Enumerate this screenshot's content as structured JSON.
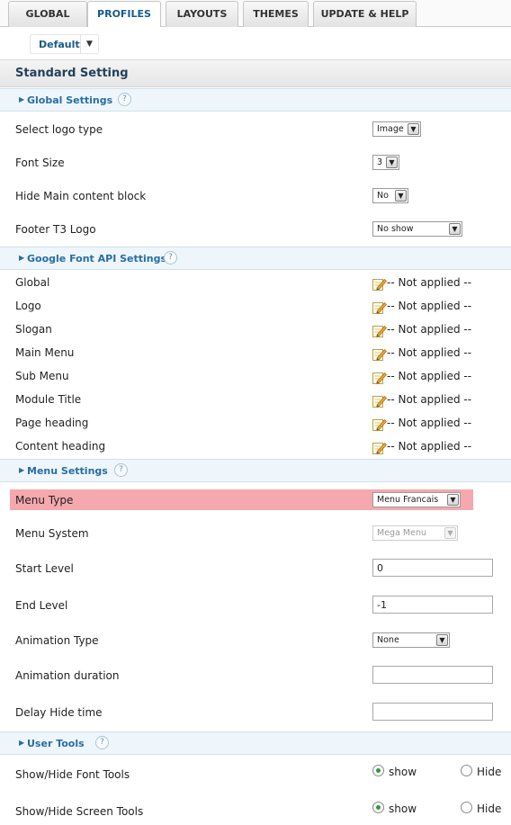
{
  "tabs": [
    "GLOBAL",
    "PROFILES",
    "LAYOUTS",
    "THEMES",
    "UPDATE & HELP"
  ],
  "active_tab": "PROFILES",
  "profile": {
    "selected": "Default"
  },
  "page_title": "Standard Setting",
  "help_glyph": "?",
  "sections": {
    "global": {
      "title": "Global Settings"
    },
    "google_font": {
      "title": "Google Font API Settings"
    },
    "menu": {
      "title": "Menu Settings"
    },
    "user_tools": {
      "title": "User Tools"
    }
  },
  "global_settings": {
    "logo_type": {
      "label": "Select logo type",
      "value": "Image"
    },
    "font_size": {
      "label": "Font Size",
      "value": "3"
    },
    "hide_main": {
      "label": "Hide Main content block",
      "value": "No"
    },
    "footer_logo": {
      "label": "Footer T3 Logo",
      "value": "No show"
    }
  },
  "google_fonts": [
    {
      "label": "Global",
      "value": "-- Not applied --"
    },
    {
      "label": "Logo",
      "value": "-- Not applied --"
    },
    {
      "label": "Slogan",
      "value": "-- Not applied --"
    },
    {
      "label": "Main Menu",
      "value": "-- Not applied --"
    },
    {
      "label": "Sub Menu",
      "value": "-- Not applied --"
    },
    {
      "label": "Module Title",
      "value": "-- Not applied --"
    },
    {
      "label": "Page heading",
      "value": "-- Not applied --"
    },
    {
      "label": "Content heading",
      "value": "-- Not applied --"
    }
  ],
  "menu_settings": {
    "menu_type": {
      "label": "Menu Type",
      "value": "Menu Francais"
    },
    "menu_system": {
      "label": "Menu System",
      "value": "Mega Menu"
    },
    "start_level": {
      "label": "Start Level",
      "value": "0"
    },
    "end_level": {
      "label": "End Level",
      "value": "-1"
    },
    "animation_type": {
      "label": "Animation Type",
      "value": "None"
    },
    "animation_duration": {
      "label": "Animation duration",
      "value": ""
    },
    "delay_hide": {
      "label": "Delay Hide time",
      "value": ""
    }
  },
  "user_tools": {
    "font_tools": {
      "label": "Show/Hide Font Tools",
      "selected": "show"
    },
    "screen_tools": {
      "label": "Show/Hide Screen Tools",
      "selected": "show"
    },
    "option_show": "show",
    "option_hide": "Hide"
  },
  "colors": {
    "accent": "#2a6da3",
    "highlight": "#f5a8ad",
    "section_bg": "#eef6fb",
    "radio_on": "#2b9a3e"
  },
  "icons": {
    "section_arrow": "triangle-right-icon",
    "help": "help-icon",
    "edit": "edit-pencil-icon",
    "dropdown": "chevron-down-icon"
  }
}
